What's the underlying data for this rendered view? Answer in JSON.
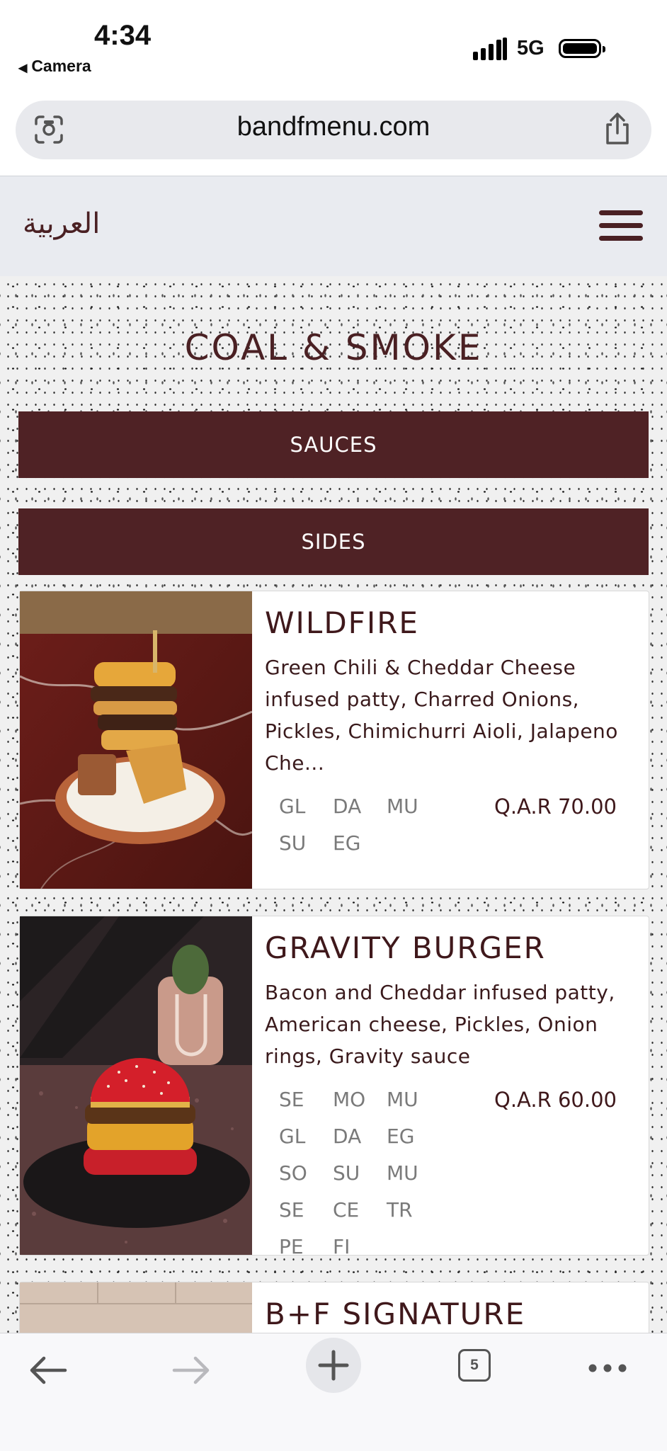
{
  "status_bar": {
    "time": "4:34",
    "back_app": "Camera",
    "network": "5G"
  },
  "browser": {
    "url": "bandfmenu.com",
    "tab_count": "5"
  },
  "header": {
    "language_link": "العربية"
  },
  "page": {
    "title": "COAL & SMOKE"
  },
  "categories": [
    {
      "label": "SAUCES"
    },
    {
      "label": "SIDES"
    }
  ],
  "items": [
    {
      "name": "WILDFIRE",
      "description": "Green Chili & Cheddar Cheese infused patty, Charred Onions, Pickles, Chimichurri Aioli, Jalapeno Che...",
      "allergens": [
        "GL",
        "DA",
        "MU",
        "SU",
        "EG"
      ],
      "price": "Q.A.R 70.00"
    },
    {
      "name": "GRAVITY BURGER",
      "description": "Bacon and Cheddar infused patty, American cheese, Pickles, Onion rings, Gravity sauce",
      "allergens": [
        "SE",
        "MO",
        "MU",
        "GL",
        "DA",
        "EG",
        "SO",
        "SU",
        "MU",
        "SE",
        "CE",
        "TR",
        "PE",
        "FI"
      ],
      "price": "Q.A.R 60.00"
    },
    {
      "name": "B+F SIGNATURE"
    }
  ],
  "colors": {
    "brand": "#4f2225",
    "header_bg": "#e9ebf0",
    "title": "#4a2023"
  }
}
